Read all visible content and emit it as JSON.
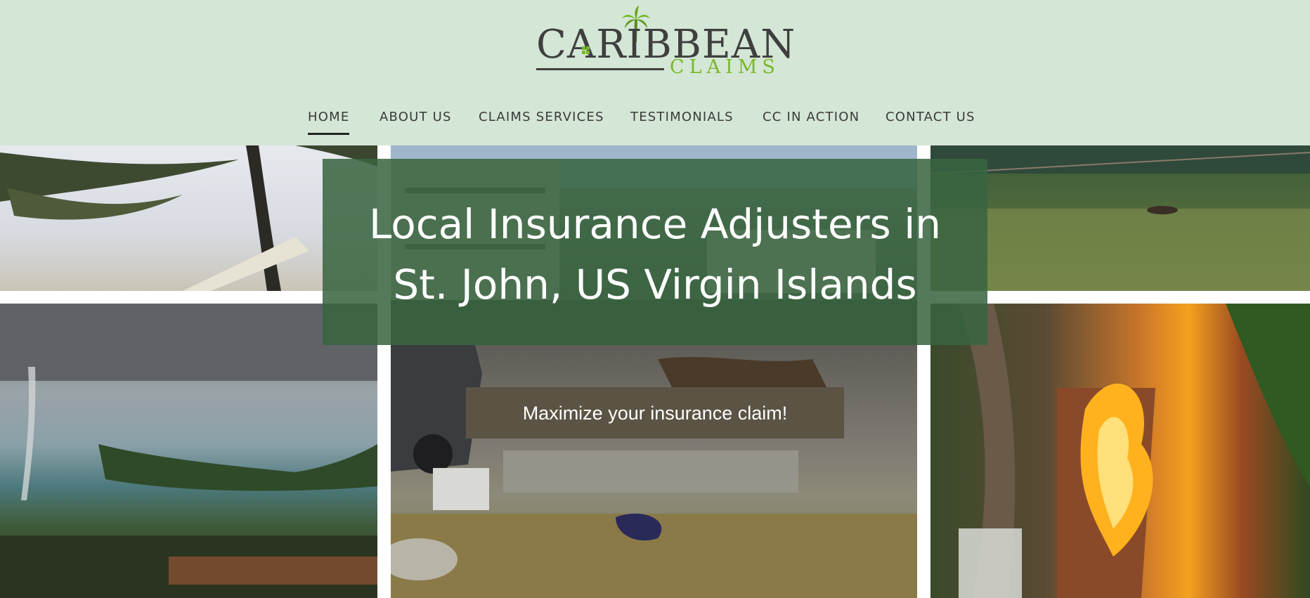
{
  "logo": {
    "line1": "CARIBBEAN",
    "line2": "CLAIMS",
    "colors": {
      "dark": "#3f3f3f",
      "green": "#7ab829"
    },
    "icons": [
      "palm-tree-icon",
      "house-window-icon"
    ]
  },
  "nav": {
    "items": [
      {
        "label": "HOME",
        "active": true
      },
      {
        "label": "ABOUT US",
        "active": false
      },
      {
        "label": "CLAIMS SERVICES",
        "active": false
      },
      {
        "label": "TESTIMONIALS",
        "active": false
      },
      {
        "label": "CC IN ACTION",
        "active": false
      },
      {
        "label": "CONTACT US",
        "active": false
      }
    ]
  },
  "hero": {
    "title_line1": "Local Insurance Adjusters in",
    "title_line2": "St. John, US Virgin Islands",
    "cta_label": "Maximize your insurance claim!"
  },
  "colors": {
    "header_bg": "#d4e6d6",
    "hero_overlay": "#386440",
    "cta_bg": "#5b5344"
  }
}
